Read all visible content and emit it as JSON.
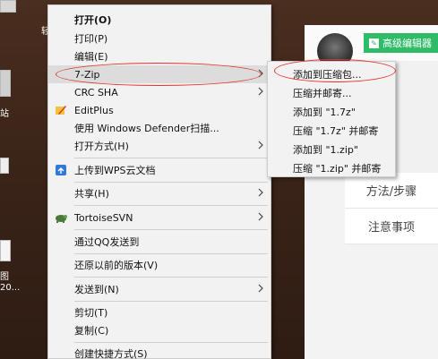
{
  "menu": {
    "items": [
      {
        "label": "打开(O)",
        "bold": true,
        "arrow": false
      },
      {
        "label": "打印(P)",
        "arrow": false
      },
      {
        "label": "编辑(E)",
        "arrow": false
      },
      {
        "label": "7-Zip",
        "arrow": true,
        "selected": true
      },
      {
        "label": "CRC SHA",
        "arrow": true
      },
      {
        "label": "EditPlus",
        "arrow": false,
        "icon": "editplus-icon"
      },
      {
        "label": "使用 Windows Defender扫描...",
        "arrow": false
      },
      {
        "label": "打开方式(H)",
        "arrow": true
      },
      {
        "label": "上传到WPS云文档",
        "arrow": false,
        "icon": "wps-cloud-icon"
      },
      {
        "label": "共享(H)",
        "arrow": true
      },
      {
        "label": "TortoiseSVN",
        "arrow": true,
        "icon": "tortoisesvn-icon"
      },
      {
        "label": "通过QQ发送到",
        "arrow": false
      },
      {
        "label": "还原以前的版本(V)",
        "arrow": false
      },
      {
        "label": "发送到(N)",
        "arrow": true
      },
      {
        "label": "剪切(T)",
        "arrow": false
      },
      {
        "label": "复制(C)",
        "arrow": false
      },
      {
        "label": "创建快捷方式(S)",
        "arrow": false
      }
    ]
  },
  "submenu": {
    "items": [
      "添加到压缩包...",
      "压缩并邮寄...",
      "添加到 \"1.7z\"",
      "压缩 \"1.7z\" 并邮寄",
      "添加到 \"1.zip\"",
      "压缩 \"1.zip\" 并邮寄"
    ]
  },
  "webpage": {
    "edit_button": "高级编辑器",
    "rows": [
      "方法/步骤",
      "注意事项"
    ]
  },
  "desktop": {
    "labels": [
      "轻",
      "站",
      "图",
      "20..."
    ]
  },
  "colors": {
    "accent_green": "#2ebc68",
    "highlight_oval": "#e0342c",
    "menu_bg": "#f2f2f2"
  }
}
